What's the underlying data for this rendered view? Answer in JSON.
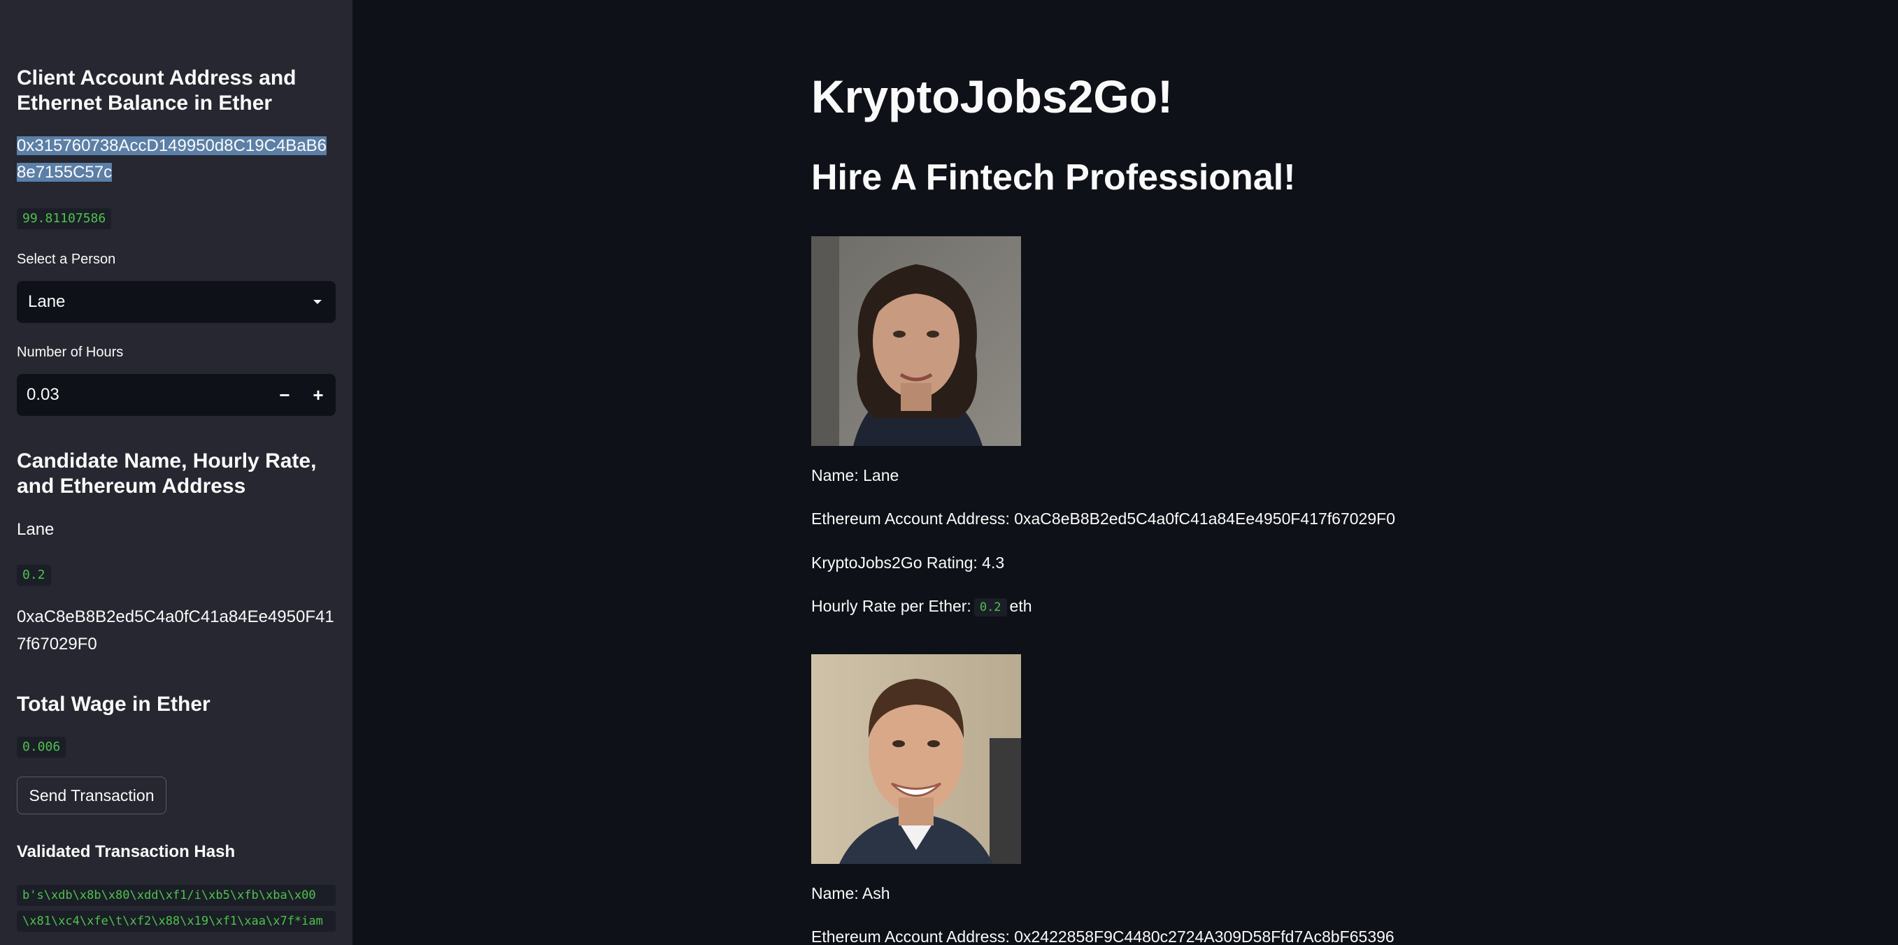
{
  "sidebar": {
    "account_heading": "Client Account Address and Ethernet Balance in Ether",
    "account_address": "0x315760738AccD149950d8C19C4BaB68e7155C57c",
    "balance": "99.81107586",
    "select_person_label": "Select a Person",
    "select_person_value": "Lane",
    "hours_label": "Number of Hours",
    "hours_value": "0.03",
    "stepper_minus": "−",
    "stepper_plus": "+",
    "candidate_heading": "Candidate Name, Hourly Rate, and Ethereum Address",
    "candidate_name": "Lane",
    "candidate_rate": "0.2",
    "candidate_address": "0xaC8eB8B2ed5C4a0fC41a84Ee4950F417f67029F0",
    "wage_heading": "Total Wage in Ether",
    "wage_value": "0.006",
    "send_button": "Send Transaction",
    "hash_heading": "Validated Transaction Hash",
    "hash_lines": [
      "b's\\xdb\\x8b\\x80\\xdd\\xf1/i\\xb5\\xfb\\xba\\x00",
      "\\x81\\xc4\\xfe\\t\\xf2\\x88\\x19\\xf1\\xaa\\x7f*iam"
    ]
  },
  "main": {
    "title": "KryptoJobs2Go!",
    "subtitle": "Hire A Fintech Professional!",
    "candidates": [
      {
        "name_text": "Name: Lane",
        "address_text": "Ethereum Account Address: 0xaC8eB8B2ed5C4a0fC41a84Ee4950F417f67029F0",
        "rating_text": "KryptoJobs2Go Rating: 4.3",
        "rate_prefix": "Hourly Rate per Ether:",
        "rate_value": "0.2",
        "rate_suffix": "eth"
      },
      {
        "name_text": "Name: Ash",
        "address_text": "Ethereum Account Address: 0x2422858F9C4480c2724A309D58Ffd7Ac8bF65396"
      }
    ]
  },
  "colors": {
    "background": "#0e1117",
    "sidebar": "#262730",
    "code_text": "#4fc14f",
    "highlight": "#5b7fa6"
  }
}
